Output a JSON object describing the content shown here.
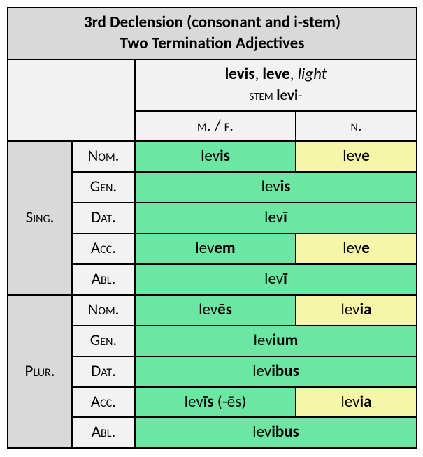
{
  "title_line1": "3rd Declension (consonant and i-stem)",
  "title_line2": "Two Termination Adjectives",
  "header": {
    "form1": "levis",
    "form2": "leve",
    "gloss": "light",
    "stem_label": "stem",
    "stem_value": "levi",
    "stem_suffix": "-",
    "mf": "m. / f.",
    "n": "n."
  },
  "numbers": {
    "sing": "Sing.",
    "plur": "Plur."
  },
  "cases": {
    "nom": "Nom.",
    "gen": "Gen.",
    "dat": "Dat.",
    "acc": "Acc.",
    "abl": "Abl."
  },
  "sing": {
    "nom_mf": {
      "root": "lev",
      "end": "is"
    },
    "nom_n": {
      "root": "lev",
      "end": "e"
    },
    "gen": {
      "root": "lev",
      "end": "is"
    },
    "dat": {
      "root": "lev",
      "end": "ī"
    },
    "acc_mf": {
      "root": "lev",
      "end": "em"
    },
    "acc_n": {
      "root": "lev",
      "end": "e"
    },
    "abl": {
      "root": "lev",
      "end": "ī"
    }
  },
  "plur": {
    "nom_mf": {
      "root": "lev",
      "end": "ēs"
    },
    "nom_n": {
      "root": "lev",
      "end": "ia"
    },
    "gen": {
      "root": "lev",
      "end": "ium"
    },
    "dat": {
      "root": "lev",
      "end": "ibus"
    },
    "acc_mf": {
      "root": "lev",
      "end": "īs",
      "extra": " (-ēs)"
    },
    "acc_n": {
      "root": "lev",
      "end": "ia"
    },
    "abl": {
      "root": "lev",
      "end": "ibus"
    }
  }
}
